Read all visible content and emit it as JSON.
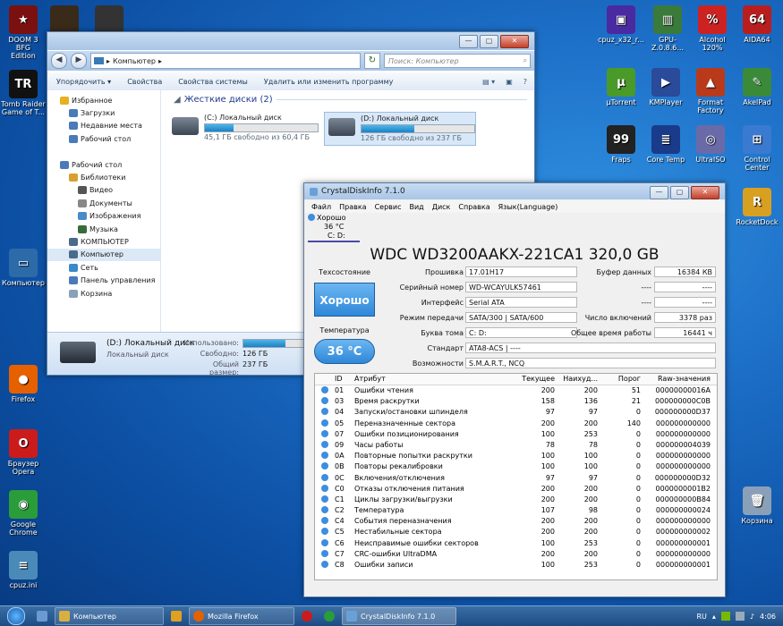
{
  "desktop_left": [
    {
      "label": "DOOM 3 BFG\nEdition",
      "color": "#7a1010",
      "glyph": "★"
    },
    {
      "label": "",
      "color": "#3a2a1a",
      "glyph": ""
    },
    {
      "label": "",
      "color": "#333",
      "glyph": ""
    },
    {
      "label": "Tomb Raider\nGame of T...",
      "color": "#111",
      "glyph": "TR"
    },
    {
      "label": "Компьютер",
      "color": "#2c6aa8",
      "glyph": "▭"
    },
    {
      "label": "Firefox",
      "color": "#e66000",
      "glyph": "●"
    },
    {
      "label": "Браузер\nOpera",
      "color": "#cc1b1b",
      "glyph": "O"
    },
    {
      "label": "Google\nChrome",
      "color": "#2a9d3a",
      "glyph": "◉"
    },
    {
      "label": "cpuz.ini",
      "color": "#4a8ab8",
      "glyph": "≡"
    }
  ],
  "desktop_right": [
    {
      "label": "cpuz_x32_r...",
      "color": "#4a2aa0",
      "glyph": "▣"
    },
    {
      "label": "GPU-Z.0.8.6...",
      "color": "#3a7a3a",
      "glyph": "▥"
    },
    {
      "label": "Alcohol\n120%",
      "color": "#c22",
      "glyph": "%"
    },
    {
      "label": "AIDA64",
      "color": "#b81e1e",
      "glyph": "64"
    },
    {
      "label": "µTorrent",
      "color": "#4a9a2a",
      "glyph": "µ"
    },
    {
      "label": "KMPlayer",
      "color": "#2a4a9a",
      "glyph": "▶"
    },
    {
      "label": "Format\nFactory",
      "color": "#b83a1a",
      "glyph": "▲"
    },
    {
      "label": "AkelPad",
      "color": "#3a8a3a",
      "glyph": "✎"
    },
    {
      "label": "Fraps",
      "color": "#222",
      "glyph": "99"
    },
    {
      "label": "Core Temp",
      "color": "#1a3a8a",
      "glyph": "≣"
    },
    {
      "label": "UltraISO",
      "color": "#6a6aa8",
      "glyph": "◎"
    },
    {
      "label": "Control\nCenter",
      "color": "#3a7ad0",
      "glyph": "⊞"
    },
    {
      "label": "RocketDock",
      "color": "#d8a020",
      "glyph": "R"
    },
    {
      "label": "Корзина",
      "color": "#8aa0b8",
      "glyph": "🗑"
    }
  ],
  "explorer": {
    "address": "Компьютер",
    "search_placeholder": "Поиск: Компьютер",
    "commands": [
      "Упорядочить ▾",
      "Свойства",
      "Свойства системы",
      "Удалить или изменить программу"
    ],
    "nav": [
      {
        "label": "Избранное",
        "indent": 0,
        "color": "#e8b020"
      },
      {
        "label": "Загрузки",
        "indent": 1,
        "color": "#4a7ab8"
      },
      {
        "label": "Недавние места",
        "indent": 1,
        "color": "#4a7ab8"
      },
      {
        "label": "Рабочий стол",
        "indent": 1,
        "color": "#4a7ab8"
      },
      {
        "label": "",
        "indent": 0,
        "color": ""
      },
      {
        "label": "Рабочий стол",
        "indent": 0,
        "color": "#4a7ab8"
      },
      {
        "label": "Библиотеки",
        "indent": 1,
        "color": "#d8a030"
      },
      {
        "label": "Видео",
        "indent": 2,
        "color": "#555"
      },
      {
        "label": "Документы",
        "indent": 2,
        "color": "#888"
      },
      {
        "label": "Изображения",
        "indent": 2,
        "color": "#4a8ac8"
      },
      {
        "label": "Музыка",
        "indent": 2,
        "color": "#3a6a3a"
      },
      {
        "label": "КОМПЬЮТЕР",
        "indent": 1,
        "color": "#4a6a8a"
      },
      {
        "label": "Компьютер",
        "indent": 1,
        "color": "#4a6a8a"
      },
      {
        "label": "Сеть",
        "indent": 1,
        "color": "#3a8ac8"
      },
      {
        "label": "Панель управления",
        "indent": 1,
        "color": "#4a7ab8"
      },
      {
        "label": "Корзина",
        "indent": 1,
        "color": "#8aa0b8"
      }
    ],
    "group_title": "Жесткие диски (2)",
    "drives": [
      {
        "name": "(C:) Локальный диск",
        "free": "45,1 ГБ свободно из 60,4 ГБ",
        "used": 0.25
      },
      {
        "name": "(D:) Локальный диск",
        "free": "126 ГБ свободно из 237 ГБ",
        "used": 0.47
      }
    ],
    "details": {
      "name": "(D:) Локальный диск",
      "type": "Локальный диск",
      "used_label": "Использовано:",
      "free_label": "Свободно:",
      "free_value": "126 ГБ",
      "total_label": "Общий размер:",
      "total_value": "237 ГБ",
      "used": 0.47
    }
  },
  "cdi": {
    "title": "CrystalDiskInfo 7.1.0",
    "menu": [
      "Файл",
      "Правка",
      "Сервис",
      "Вид",
      "Диск",
      "Справка",
      "Язык(Language)"
    ],
    "tab": {
      "status": "Хорошо",
      "temp": "36 °C",
      "drives": "C: D:"
    },
    "model": "WDC WD3200AAKX-221CA1 320,0 GB",
    "health_label": "Техсостояние",
    "health_value": "Хорошо",
    "temp_label": "Температура",
    "temp_value": "36 °C",
    "firmware_label": "Прошивка",
    "firmware": "17.01H17",
    "serial_label": "Серийный номер",
    "serial": "WD-WCAYULK57461",
    "interface_label": "Интерфейс",
    "interface": "Serial ATA",
    "transfer_label": "Режим передачи",
    "transfer": "SATA/300 | SATA/600",
    "letters_label": "Буква тома",
    "letters": "C: D:",
    "standard_label": "Стандарт",
    "standard": "ATA8-ACS | ----",
    "features_label": "Возможности",
    "features": "S.M.A.R.T., NCQ",
    "buffer_label": "Буфер данных",
    "buffer": "16384 КВ",
    "na1_label": "----",
    "na1": "----",
    "na2_label": "----",
    "na2": "----",
    "poweron_count_label": "Число включений",
    "poweron_count": "3378 раз",
    "poweron_hours_label": "Общее время работы",
    "poweron_hours": "16441 ч",
    "smart_headers": [
      "ID",
      "Атрибут",
      "Текущее",
      "Наихуд...",
      "Порог",
      "Raw-значения"
    ],
    "smart": [
      [
        "01",
        "Ошибки чтения",
        "200",
        "200",
        "51",
        "00000000016A"
      ],
      [
        "03",
        "Время раскрутки",
        "158",
        "136",
        "21",
        "000000000C0B"
      ],
      [
        "04",
        "Запуски/остановки шпинделя",
        "97",
        "97",
        "0",
        "000000000D37"
      ],
      [
        "05",
        "Переназначенные сектора",
        "200",
        "200",
        "140",
        "000000000000"
      ],
      [
        "07",
        "Ошибки позиционирования",
        "100",
        "253",
        "0",
        "000000000000"
      ],
      [
        "09",
        "Часы работы",
        "78",
        "78",
        "0",
        "000000004039"
      ],
      [
        "0A",
        "Повторные попытки раскрутки",
        "100",
        "100",
        "0",
        "000000000000"
      ],
      [
        "0B",
        "Повторы рекалибровки",
        "100",
        "100",
        "0",
        "000000000000"
      ],
      [
        "0C",
        "Включения/отключения",
        "97",
        "97",
        "0",
        "000000000D32"
      ],
      [
        "C0",
        "Отказы отключения питания",
        "200",
        "200",
        "0",
        "0000000001B2"
      ],
      [
        "C1",
        "Циклы загрузки/выгрузки",
        "200",
        "200",
        "0",
        "000000000B84"
      ],
      [
        "C2",
        "Температура",
        "107",
        "98",
        "0",
        "000000000024"
      ],
      [
        "C4",
        "События переназначения",
        "200",
        "200",
        "0",
        "000000000000"
      ],
      [
        "C5",
        "Нестабильные сектора",
        "200",
        "200",
        "0",
        "000000000002"
      ],
      [
        "C6",
        "Неисправимые ошибки секторов",
        "100",
        "253",
        "0",
        "000000000001"
      ],
      [
        "C7",
        "CRC-ошибки UltraDMA",
        "200",
        "200",
        "0",
        "000000000000"
      ],
      [
        "C8",
        "Ошибки записи",
        "100",
        "253",
        "0",
        "000000000001"
      ]
    ]
  },
  "taskbar": {
    "explorer_btn": "Компьютер",
    "firefox_btn": "Mozilla Firefox",
    "cdi_btn": "CrystalDiskInfo 7.1.0",
    "lang": "RU",
    "clock": "4:06"
  }
}
